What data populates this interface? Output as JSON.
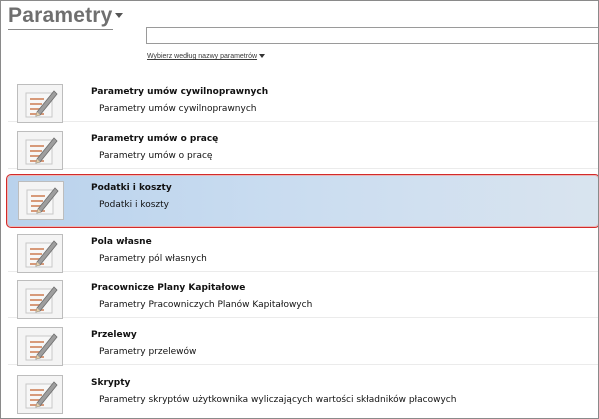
{
  "header": {
    "title": "Parametry"
  },
  "search": {
    "value": "",
    "placeholder": ""
  },
  "filter": {
    "label": "Wybierz według nazwy parametrów"
  },
  "items": [
    {
      "name": "Parametry umów cywilnoprawnych",
      "description": "Parametry umów cywilnoprawnych",
      "selected": false
    },
    {
      "name": "Parametry umów o pracę",
      "description": "Parametry umów o pracę",
      "selected": false
    },
    {
      "name": "Podatki i koszty",
      "description": "Podatki i koszty",
      "selected": true
    },
    {
      "name": "Pola własne",
      "description": "Parametry pól własnych",
      "selected": false
    },
    {
      "name": "Pracownicze Plany Kapitałowe",
      "description": "Parametry Pracowniczych Planów Kapitałowych",
      "selected": false
    },
    {
      "name": "Przelewy",
      "description": "Parametry przelewów",
      "selected": false
    },
    {
      "name": "Skrypty",
      "description": "Parametry skryptów użytkownika wyliczających wartości składników płacowych",
      "selected": false
    }
  ],
  "icon": {
    "name": "document-pencil-icon"
  },
  "colors": {
    "selected_border": "#d32a2a",
    "selected_fill": "#bfd6ee",
    "title": "#6f6f6f"
  }
}
